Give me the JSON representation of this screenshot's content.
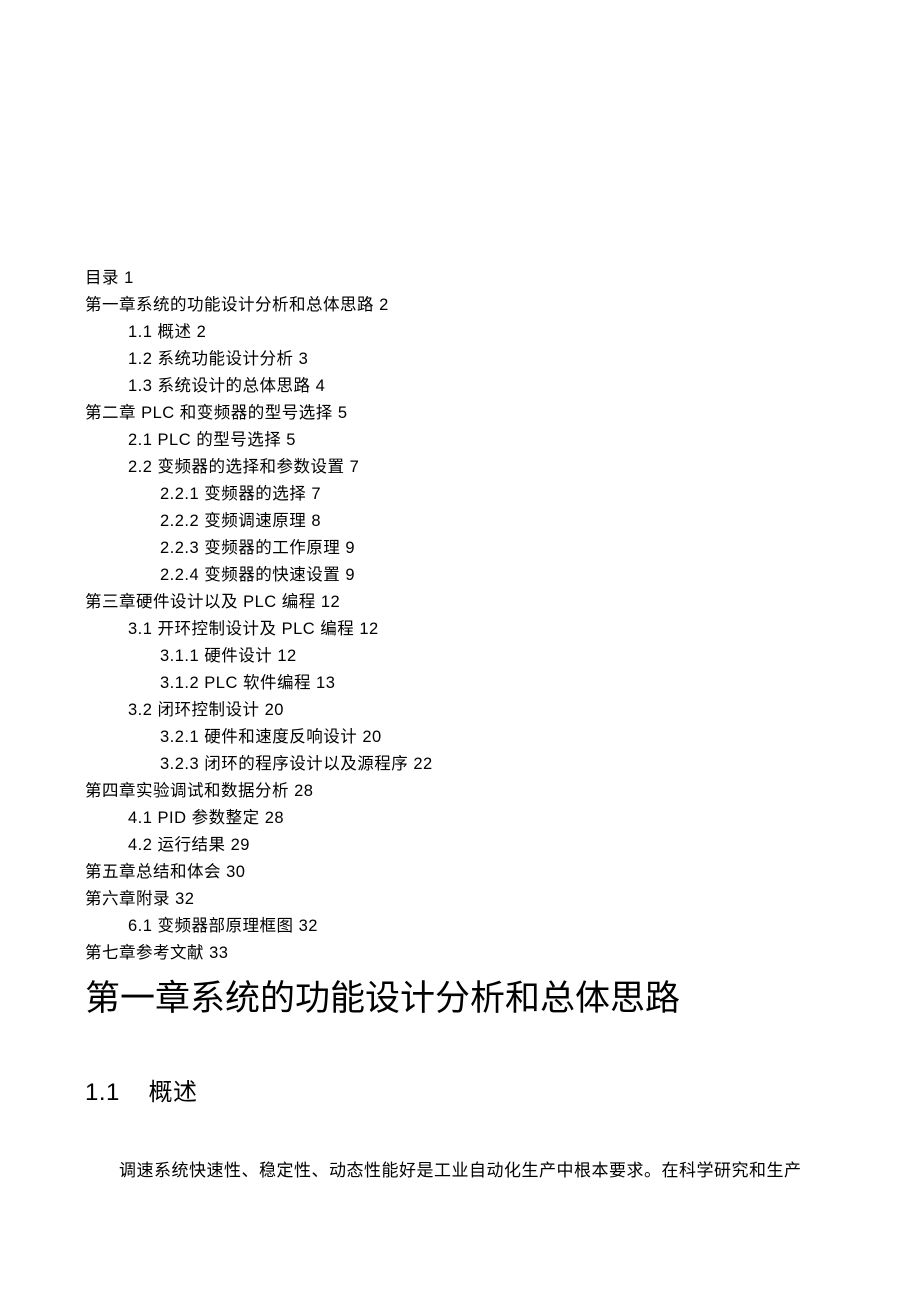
{
  "toc": {
    "l0": "目录 1",
    "l1": "第一章系统的功能设计分析和总体思路 2",
    "l2": "1.1    概述 2",
    "l3": "1.2    系统功能设计分析 3",
    "l4": "1.3    系统设计的总体思路 4",
    "l5": "第二章 PLC 和变频器的型号选择 5",
    "l6": "2.1  PLC 的型号选择 5",
    "l7": "2.2  变频器的选择和参数设置 7",
    "l8": "2.2.1  变频器的选择 7",
    "l9": "2.2.2  变频调速原理 8",
    "l10": "2.2.3  变频器的工作原理 9",
    "l11": "2.2.4  变频器的快速设置 9",
    "l12": "第三章硬件设计以及 PLC 编程 12",
    "l13": "3.1  开环控制设计及 PLC 编程 12",
    "l14": "3.1.1  硬件设计 12",
    "l15": "3.1.2  PLC 软件编程 13",
    "l16": "3.2  闭环控制设计 20",
    "l17": "3.2.1     硬件和速度反响设计 20",
    "l18": "3.2.3     闭环的程序设计以及源程序 22",
    "l19": "第四章实验调试和数据分析 28",
    "l20": "4.1    PID 参数整定 28",
    "l21": "4.2    运行结果 29",
    "l22": "第五章总结和体会 30",
    "l23": "第六章附录 32",
    "l24": "6.1    变频器部原理框图 32",
    "l25": "第七章参考文献 33"
  },
  "chapter": {
    "title": "第一章系统的功能设计分析和总体思路"
  },
  "section": {
    "num": "1.1",
    "title": "概述"
  },
  "body": {
    "p1": "调速系统快速性、稳定性、动态性能好是工业自动化生产中根本要求。在科学研究和生产"
  }
}
